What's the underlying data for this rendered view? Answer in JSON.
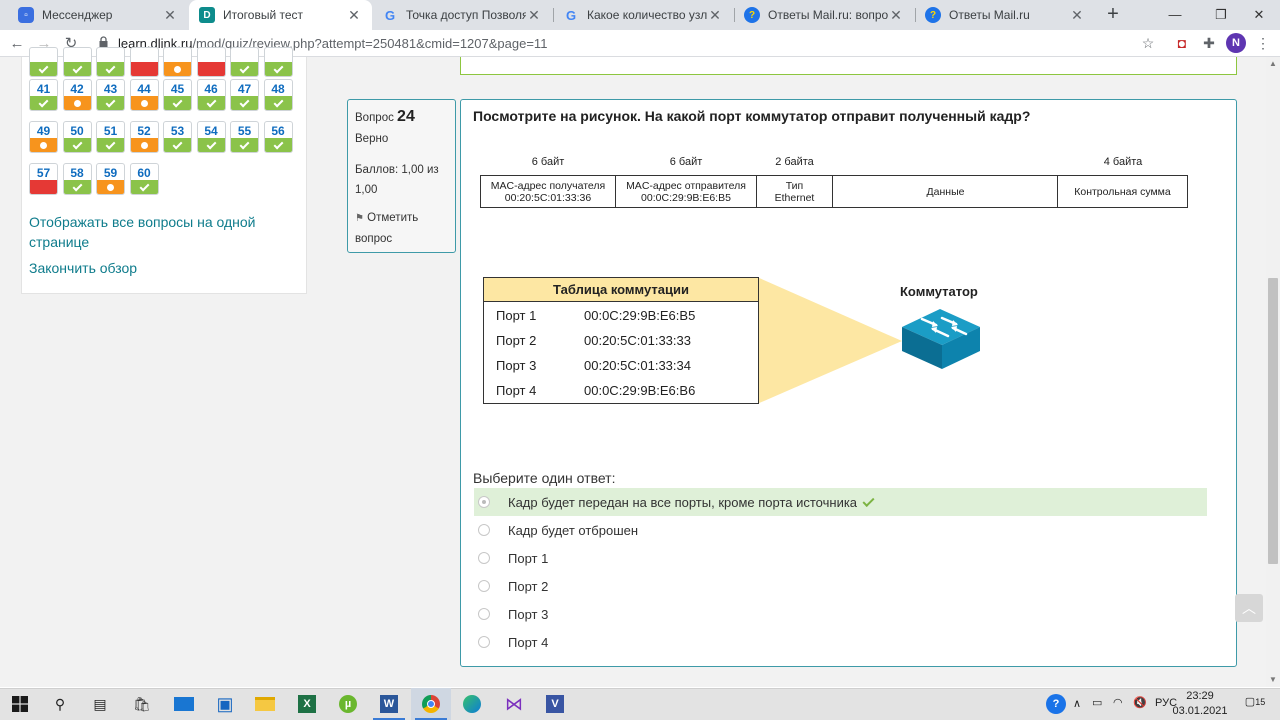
{
  "browser": {
    "tabs": [
      {
        "title": "Мессенджер",
        "icon": "messenger-icon",
        "active": false
      },
      {
        "title": "Итоговый тест",
        "icon": "dlink-icon",
        "active": true
      },
      {
        "title": "Точка доступ Позволяет об",
        "icon": "google-icon",
        "active": false
      },
      {
        "title": "Какое количество узлов до",
        "icon": "google-icon",
        "active": false
      },
      {
        "title": "Ответы Mail.ru: вопрос",
        "icon": "mailru-icon",
        "active": false
      },
      {
        "title": "Ответы Mail.ru",
        "icon": "mailru-icon",
        "active": false
      }
    ],
    "url_host": "learn.dlink.ru",
    "url_path": "/mod/quiz/review.php?attempt=250481&cmid=1207&page=11",
    "profile_initial": "N"
  },
  "quiz_nav": {
    "rows": [
      [
        {
          "n": "",
          "s": "ok"
        },
        {
          "n": "",
          "s": "ok"
        },
        {
          "n": "",
          "s": "ok"
        },
        {
          "n": "",
          "s": "wrong"
        },
        {
          "n": "",
          "s": "part"
        },
        {
          "n": "",
          "s": "wrong"
        },
        {
          "n": "",
          "s": "ok"
        },
        {
          "n": "",
          "s": "ok"
        }
      ],
      [
        {
          "n": "41",
          "s": "ok"
        },
        {
          "n": "42",
          "s": "part"
        },
        {
          "n": "43",
          "s": "ok"
        },
        {
          "n": "44",
          "s": "part"
        },
        {
          "n": "45",
          "s": "ok"
        },
        {
          "n": "46",
          "s": "ok"
        },
        {
          "n": "47",
          "s": "ok"
        },
        {
          "n": "48",
          "s": "ok"
        }
      ],
      [
        {
          "n": "49",
          "s": "part"
        },
        {
          "n": "50",
          "s": "ok"
        },
        {
          "n": "51",
          "s": "ok"
        },
        {
          "n": "52",
          "s": "part"
        },
        {
          "n": "53",
          "s": "ok"
        },
        {
          "n": "54",
          "s": "ok"
        },
        {
          "n": "55",
          "s": "ok"
        },
        {
          "n": "56",
          "s": "ok"
        }
      ],
      [
        {
          "n": "57",
          "s": "wrong"
        },
        {
          "n": "58",
          "s": "ok"
        },
        {
          "n": "59",
          "s": "part"
        },
        {
          "n": "60",
          "s": "ok"
        }
      ]
    ],
    "show_all_link": "Отображать все вопросы на одной странице",
    "finish_link": "Закончить обзор"
  },
  "question": {
    "label": "Вопрос",
    "number": "24",
    "state": "Верно",
    "grade": "Баллов: 1,00 из 1,00",
    "flag": "Отметить вопрос",
    "text": "Посмотрите на рисунок. На какой порт коммутатор отправит полученный кадр?",
    "frame": {
      "sizes": [
        "6 байт",
        "6 байт",
        "2 байта",
        "4 байта"
      ],
      "dest": [
        "MAC-адрес получателя",
        "00:20:5C:01:33:36"
      ],
      "src": [
        "MAC-адрес отправителя",
        "00:0C:29:9B:E6:B5"
      ],
      "type": [
        "Тип",
        "Ethernet"
      ],
      "data": "Данные",
      "fcs": "Контрольная сумма"
    },
    "switch_table": {
      "title": "Таблица коммутации",
      "rows": [
        {
          "port": "Порт 1",
          "mac": "00:0C:29:9B:E6:B5"
        },
        {
          "port": "Порт 2",
          "mac": "00:20:5C:01:33:33"
        },
        {
          "port": "Порт 3",
          "mac": "00:20:5C:01:33:34"
        },
        {
          "port": "Порт 4",
          "mac": "00:0C:29:9B:E6:B6"
        }
      ]
    },
    "switch_label": "Коммутатор",
    "prompt": "Выберите один ответ:",
    "answers": [
      {
        "text": "Кадр будет передан на все порты, кроме порта источника",
        "selected": true,
        "correct": true
      },
      {
        "text": "Кадр будет отброшен",
        "selected": false,
        "correct": false
      },
      {
        "text": "Порт 1",
        "selected": false,
        "correct": false
      },
      {
        "text": "Порт 2",
        "selected": false,
        "correct": false
      },
      {
        "text": "Порт 3",
        "selected": false,
        "correct": false
      },
      {
        "text": "Порт 4",
        "selected": false,
        "correct": false
      }
    ]
  },
  "taskbar": {
    "language": "РУС",
    "time": "23:29",
    "date": "03.01.2021",
    "notifications": "15"
  },
  "colors": {
    "accent": "#0f6cbf",
    "ok": "#8bc34a",
    "partial": "#f7941d",
    "wrong": "#e53935",
    "correct_bg": "#dff0d8"
  }
}
